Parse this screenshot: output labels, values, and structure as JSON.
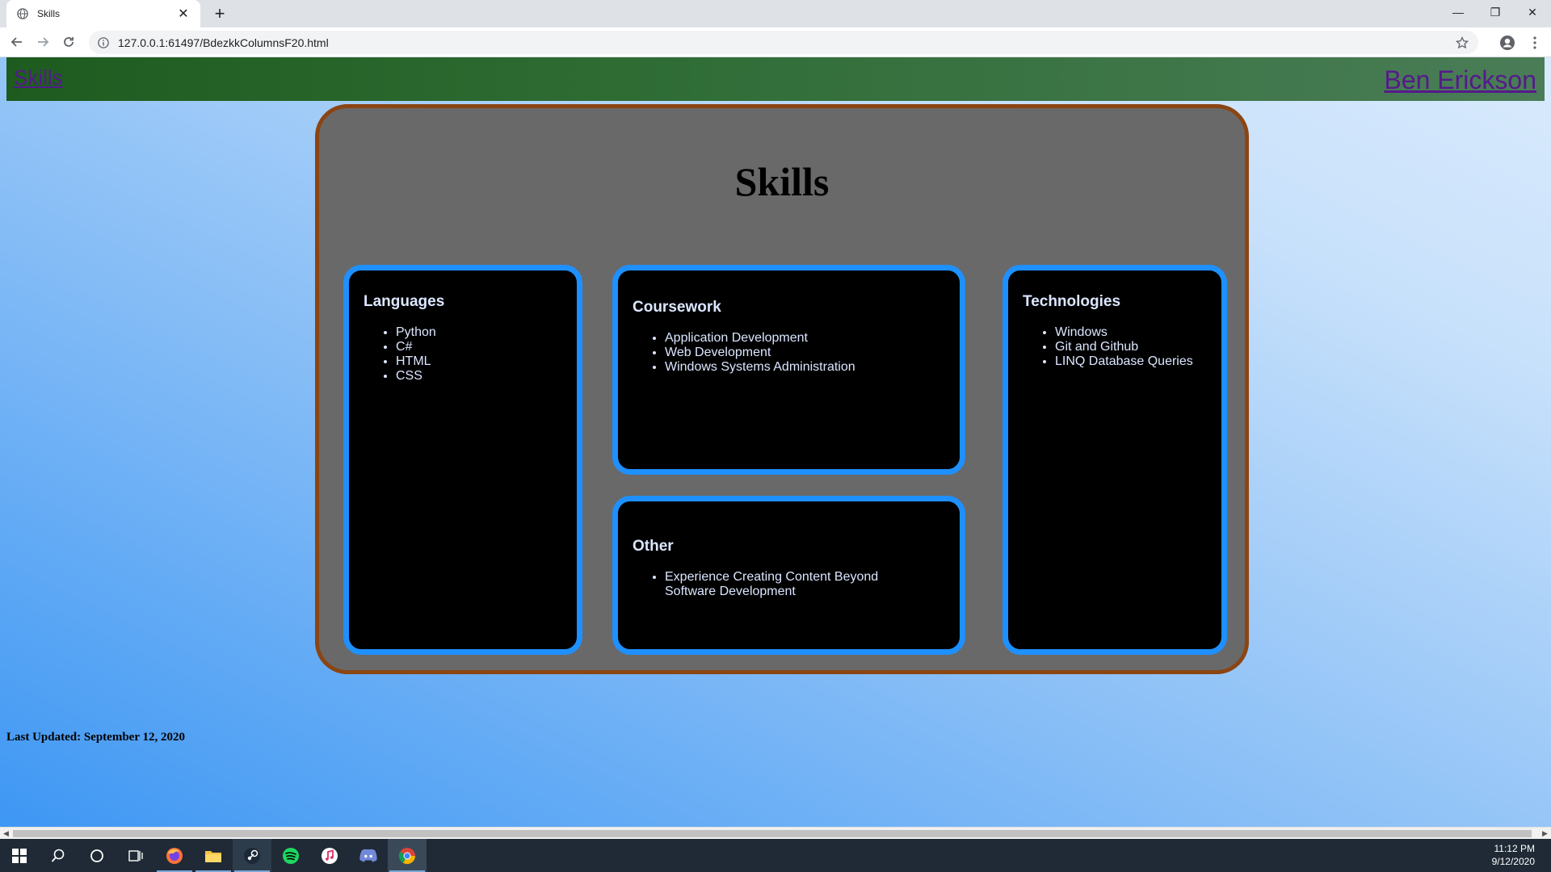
{
  "browser": {
    "tab_title": "Skills",
    "new_tab_label": "+",
    "close_label": "✕",
    "window": {
      "minimize": "—",
      "restore": "❐",
      "close": "✕"
    },
    "url": "127.0.0.1:61497/BdezkkColumnsF20.html",
    "icons": {
      "back": "arrow-left-icon",
      "forward": "arrow-right-icon",
      "reload": "reload-icon",
      "info": "info-icon",
      "star": "star-icon",
      "profile": "profile-icon",
      "menu": "kebab-menu-icon"
    }
  },
  "header": {
    "left_link": "Skills",
    "right_link": "Ben Erickson"
  },
  "main": {
    "title": "Skills",
    "cards": {
      "languages": {
        "title": "Languages",
        "items": [
          "Python",
          "C#",
          "HTML",
          "CSS"
        ]
      },
      "coursework": {
        "title": "Coursework",
        "items": [
          "Application Development",
          "Web Development",
          "Windows Systems Administration"
        ]
      },
      "technologies": {
        "title": "Technologies",
        "items": [
          "Windows",
          "Git and Github",
          "LINQ Database Queries"
        ]
      },
      "other": {
        "title": "Other",
        "items": [
          "Experience Creating Content Beyond Software Development"
        ]
      }
    }
  },
  "footer": {
    "last_updated": "Last Updated: September 12, 2020"
  },
  "taskbar": {
    "time": "11:12 PM",
    "date": "9/12/2020",
    "apps": [
      "windows-start-icon",
      "search-icon",
      "cortana-icon",
      "task-view-icon",
      "firefox-icon",
      "file-explorer-icon",
      "steam-icon",
      "spotify-icon",
      "itunes-icon",
      "discord-icon",
      "chrome-icon"
    ]
  },
  "colors": {
    "header_green": "#2e6c34",
    "panel_gray": "#696969",
    "panel_border": "#8b4513",
    "card_border": "#1e90ff",
    "link": "#551a8b"
  }
}
